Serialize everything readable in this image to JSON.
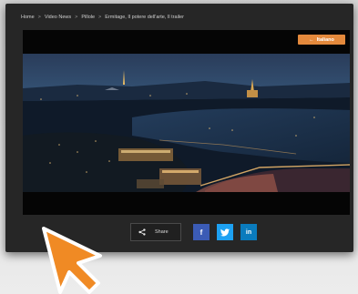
{
  "breadcrumb": {
    "items": [
      "Home",
      "Video News",
      "Pillole",
      "Ermitage, Il potere dell'arte, Il trailer"
    ],
    "separator": ">"
  },
  "video": {
    "back_label": "Italiano",
    "back_arrow": "←"
  },
  "share": {
    "label": "Share",
    "icons": {
      "share": "share-icon",
      "facebook": "f",
      "twitter": "twitter-bird-icon",
      "linkedin": "in"
    }
  },
  "colors": {
    "panel": "#262626",
    "accent": "#e4893c",
    "facebook": "#3b5bb5",
    "twitter": "#1da1f2",
    "linkedin": "#0a7bbd",
    "cursor": "#f08a24"
  }
}
